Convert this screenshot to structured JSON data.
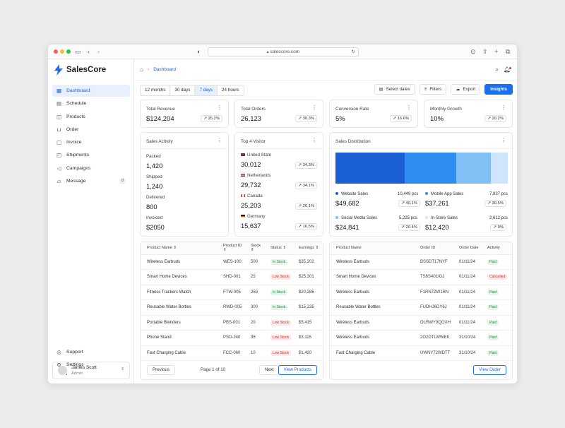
{
  "browser": {
    "url": "salescore.com"
  },
  "app": {
    "name": "SalesCore",
    "accent": "#1a6ef0"
  },
  "sidebar": {
    "items": [
      {
        "label": "Dashboard",
        "icon": "dashboard-icon"
      },
      {
        "label": "Schedule",
        "icon": "calendar-icon"
      },
      {
        "label": "Products",
        "icon": "box-icon"
      },
      {
        "label": "Order",
        "icon": "cart-icon"
      },
      {
        "label": "Invoice",
        "icon": "invoice-icon"
      },
      {
        "label": "Shipments",
        "icon": "truck-icon"
      },
      {
        "label": "Campaigns",
        "icon": "megaphone-icon"
      },
      {
        "label": "Message",
        "icon": "message-icon",
        "count": "8"
      }
    ],
    "bottom": [
      {
        "label": "Support",
        "icon": "support-icon"
      },
      {
        "label": "Settings",
        "icon": "gear-icon"
      }
    ],
    "user": {
      "name": "James Scott",
      "role": "Admin"
    }
  },
  "header": {
    "breadcrumb": "Dashboard"
  },
  "toolbar": {
    "ranges": [
      "12 months",
      "30 days",
      "7 days",
      "24 hours"
    ],
    "active_range": "7 days",
    "select_dates": "Select dates",
    "filters": "Filters",
    "export": "Export",
    "insights": "Insights"
  },
  "kpis": [
    {
      "label": "Total Revenue",
      "value": "$124,204",
      "change": "25,2%"
    },
    {
      "label": "Total Orders",
      "value": "26,123",
      "change": "30,3%"
    },
    {
      "label": "Conversion Rate",
      "value": "5%",
      "change": "16.6%"
    },
    {
      "label": "Monthly Growth",
      "value": "10%",
      "change": "20,2%"
    }
  ],
  "sales_activity": {
    "title": "Sales Activity",
    "items": [
      {
        "label": "Packed",
        "value": "1,420"
      },
      {
        "label": "Shipped",
        "value": "1,240"
      },
      {
        "label": "Delivered",
        "value": "800"
      },
      {
        "label": "Invoiced",
        "value": "$2050"
      }
    ]
  },
  "top_visitor": {
    "title": "Top 4 Visitor",
    "items": [
      {
        "country": "United State",
        "value": "30,012",
        "change": "34,3%"
      },
      {
        "country": "Netherlands",
        "value": "29,732",
        "change": "34,1%"
      },
      {
        "country": "Canada",
        "value": "25,203",
        "change": "26,1%"
      },
      {
        "country": "Germany",
        "value": "15,637",
        "change": "16,5%"
      }
    ]
  },
  "sales_distribution": {
    "title": "Sales Distribution",
    "segments": [
      {
        "label": "Website Sales",
        "pcs": "10,449 pcs",
        "value": "$49,682",
        "change": "40,1%",
        "color": "#1a5fd6",
        "share": 0.4
      },
      {
        "label": "Mobile App Sales",
        "pcs": "7,837 pcs",
        "value": "$37,261",
        "change": "30,5%",
        "color": "#2f8cf0",
        "share": 0.3
      },
      {
        "label": "Social Media Sales",
        "pcs": "5,225 pcs",
        "value": "$24,841",
        "change": "20.4%",
        "color": "#80c0f5",
        "share": 0.2
      },
      {
        "label": "In-Store Sales",
        "pcs": "2,612 pcs",
        "value": "$12,420",
        "change": "9%",
        "color": "#cfe5fb",
        "share": 0.1
      }
    ]
  },
  "products_table": {
    "columns": [
      "Product Name",
      "Product ID",
      "Stock",
      "Status",
      "Earnings"
    ],
    "rows": [
      {
        "name": "Wireless Earbuds",
        "id": "WES-100",
        "stock": "500",
        "status": "In Stock",
        "earnings": "$35,202"
      },
      {
        "name": "Smart Home Devices",
        "id": "SHD-001",
        "stock": "25",
        "status": "Low Stock",
        "earnings": "$25,301"
      },
      {
        "name": "Fitness Trackers Watch",
        "id": "FTW-005",
        "stock": "250",
        "status": "In Stock",
        "earnings": "$20,286"
      },
      {
        "name": "Reusable Water Bottles",
        "id": "RWD-005",
        "stock": "300",
        "status": "In Stock",
        "earnings": "$15,235"
      },
      {
        "name": "Portable Blenders",
        "id": "PBS-001",
        "stock": "20",
        "status": "Low Stock",
        "earnings": "$5,415"
      },
      {
        "name": "Phone Stand",
        "id": "PSD-240",
        "stock": "35",
        "status": "Low Stock",
        "earnings": "$3,115"
      },
      {
        "name": "Fast Charging Cable",
        "id": "FCC-060",
        "stock": "10",
        "status": "Low Stock",
        "earnings": "$1,420"
      }
    ],
    "previous": "Previous",
    "page": "Page 1 of 10",
    "next": "Next",
    "view": "View Products"
  },
  "orders_table": {
    "columns": [
      "Product Name",
      "Order ID",
      "Order Date",
      "Activity"
    ],
    "rows": [
      {
        "name": "Wireless Earbuds",
        "id": "BSSDT17NYF",
        "date": "01/11/24",
        "activity": "Paid"
      },
      {
        "name": "Smart Home Devices",
        "id": "TS6S401IGJ",
        "date": "01/11/24",
        "activity": "Cancelled"
      },
      {
        "name": "Wireless Earbuds",
        "id": "F1RN7ZW1RN",
        "date": "01/11/24",
        "activity": "Paid"
      },
      {
        "name": "Reusable Water Bottles",
        "id": "FUDHJ6DY6J",
        "date": "01/11/24",
        "activity": "Paid"
      },
      {
        "name": "Wireless Earbuds",
        "id": "OLRWY9QOXH",
        "date": "01/11/24",
        "activity": "Paid"
      },
      {
        "name": "Wireless Earbuds",
        "id": "2O2DTLWWEK",
        "date": "31/10/24",
        "activity": "Paid"
      },
      {
        "name": "Fast Charging Cable",
        "id": "UWNY72WDTT",
        "date": "31/10/24",
        "activity": "Paid"
      }
    ],
    "view": "View Order"
  }
}
